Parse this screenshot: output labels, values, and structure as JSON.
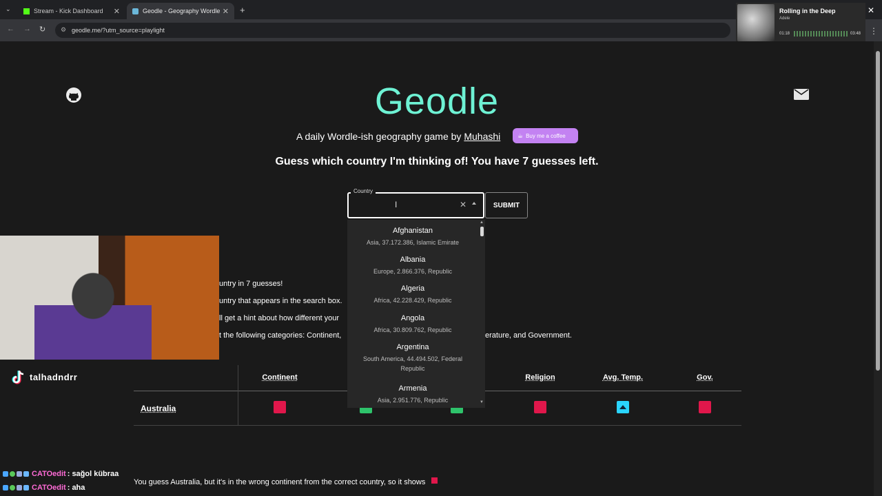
{
  "browser": {
    "tabs": [
      {
        "label": "Stream - Kick Dashboard",
        "icon": "kick-icon"
      },
      {
        "label": "Geodle - Geography Wordle",
        "icon": "geodle-icon"
      }
    ],
    "url": "geodle.me/?utm_source=playlight"
  },
  "media": {
    "title": "Rolling in the Deep",
    "artist": "Adele",
    "time_elapsed": "01:18",
    "time_total": "03:48",
    "progress": 0.34
  },
  "page": {
    "title": "Geodle",
    "subtitle_prefix": "A daily Wordle-ish geography game by",
    "author": "Muhashi",
    "coffee_label": "Buy me a coffee",
    "guess_prompt": "Guess which country I'm thinking of! You have 7 guesses left.",
    "input_label": "Country",
    "input_value": "",
    "submit_label": "SUBMIT"
  },
  "dropdown": [
    {
      "name": "Afghanistan",
      "info": "Asia, 37.172.386, Islamic Emirate"
    },
    {
      "name": "Albania",
      "info": "Europe, 2.866.376, Republic"
    },
    {
      "name": "Algeria",
      "info": "Africa, 42.228.429, Republic"
    },
    {
      "name": "Angola",
      "info": "Africa, 30.809.762, Republic"
    },
    {
      "name": "Argentina",
      "info": "South America, 44.494.502, Federal Republic"
    },
    {
      "name": "Armenia",
      "info": "Asia, 2.951.776, Republic"
    }
  ],
  "howto": {
    "line1": "untry in 7 guesses!",
    "line2": "untry that appears in the search box.",
    "line3": "ll get a hint about how different your",
    "line4": "t the following categories: Continent,",
    "line4_end": "erature, and Government."
  },
  "streamer": {
    "handle": "talhadndrr"
  },
  "table": {
    "headers": [
      "Continent",
      "Religion",
      "Avg. Temp.",
      "Gov."
    ],
    "row_name": "Australia"
  },
  "chat": [
    {
      "user": "CATOedit",
      "message": ": sağol kübraa"
    },
    {
      "user": "CATOedit",
      "message": ": aha"
    }
  ],
  "explanation": "You guess Australia, but it's in the wrong continent from the correct country, so it shows",
  "colors": {
    "accent": "#6ef2d4",
    "wrong": "#e0174b",
    "correct": "#2ec36b",
    "temp": "#2ad4ff",
    "coffee": "#c382f2"
  }
}
